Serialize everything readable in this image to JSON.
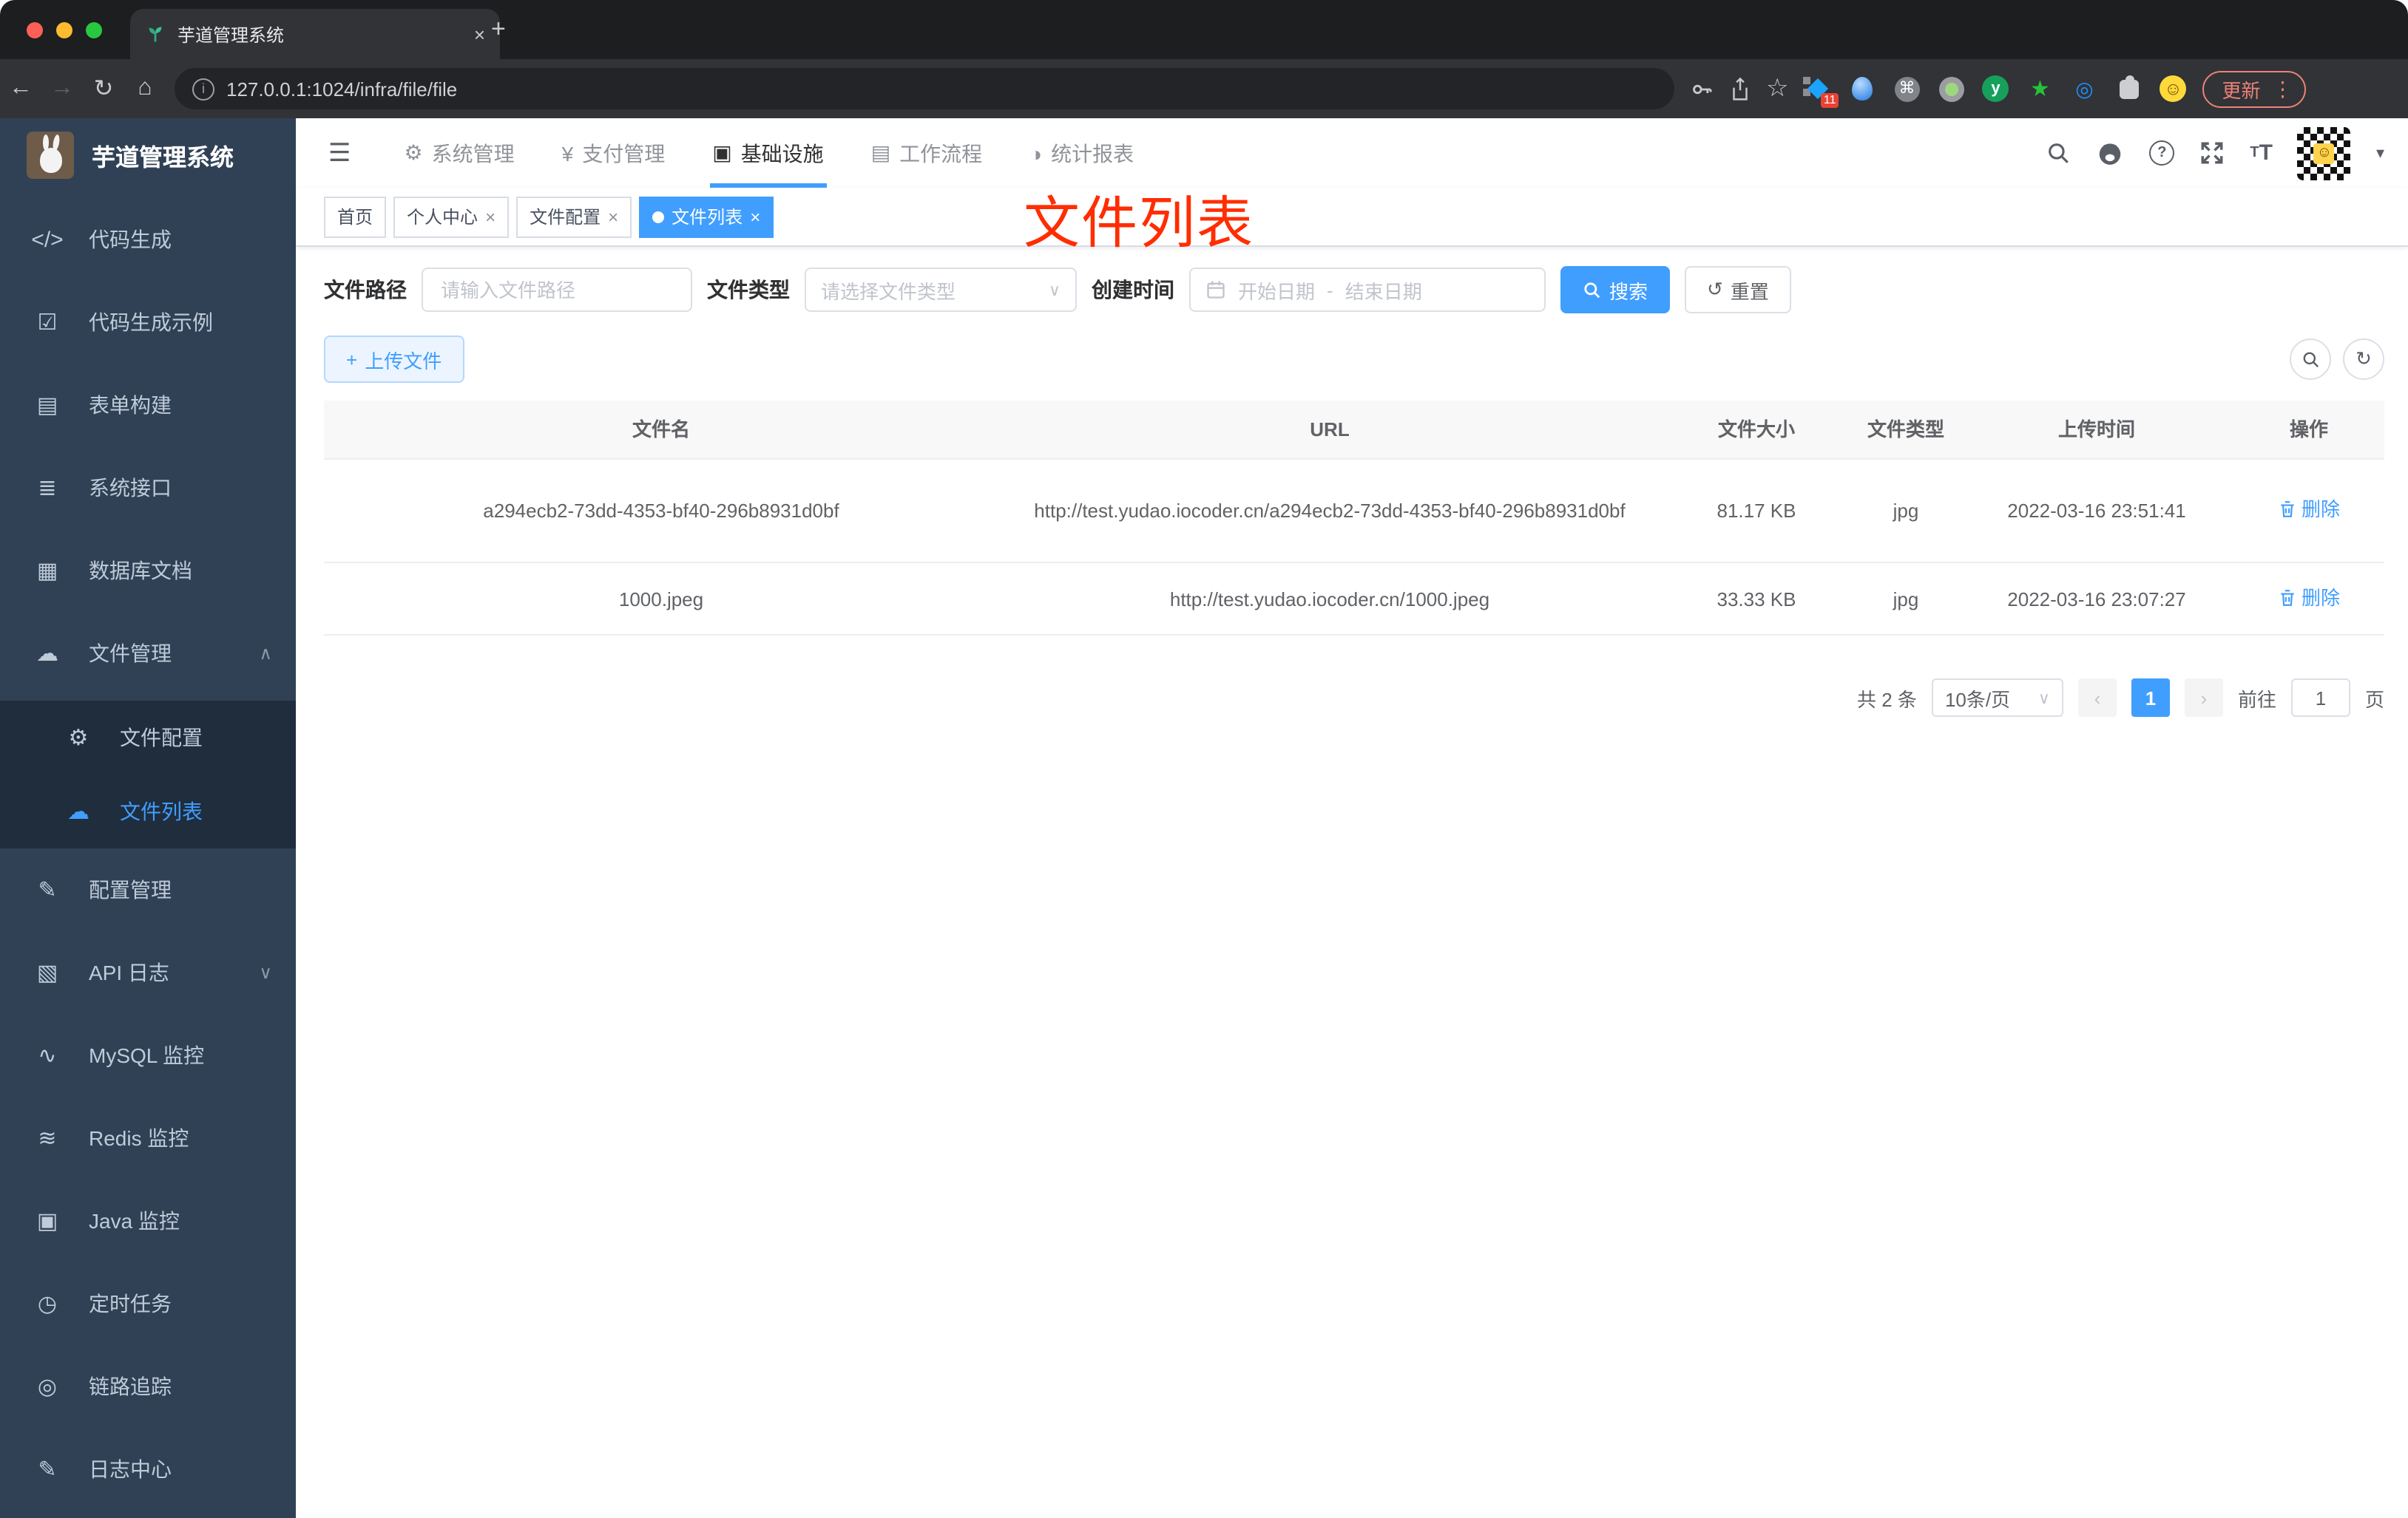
{
  "browser": {
    "tab_title": "芋道管理系统",
    "url": "127.0.0.1:1024/infra/file/file",
    "update_label": "更新",
    "extension_badge": "11"
  },
  "header": {
    "nav": [
      {
        "label": "系统管理"
      },
      {
        "label": "支付管理"
      },
      {
        "label": "基础设施"
      },
      {
        "label": "工作流程"
      },
      {
        "label": "统计报表"
      }
    ]
  },
  "sidebar": {
    "title": "芋道管理系统",
    "items": [
      {
        "label": "代码生成"
      },
      {
        "label": "代码生成示例"
      },
      {
        "label": "表单构建"
      },
      {
        "label": "系统接口"
      },
      {
        "label": "数据库文档"
      },
      {
        "label": "文件管理"
      },
      {
        "label": "文件配置"
      },
      {
        "label": "文件列表"
      },
      {
        "label": "配置管理"
      },
      {
        "label": "API 日志"
      },
      {
        "label": "MySQL 监控"
      },
      {
        "label": "Redis 监控"
      },
      {
        "label": "Java 监控"
      },
      {
        "label": "定时任务"
      },
      {
        "label": "链路追踪"
      },
      {
        "label": "日志中心"
      }
    ]
  },
  "tags": [
    {
      "label": "首页"
    },
    {
      "label": "个人中心"
    },
    {
      "label": "文件配置"
    },
    {
      "label": "文件列表"
    }
  ],
  "annotation": {
    "text": "文件列表"
  },
  "filters": {
    "path_label": "文件路径",
    "path_placeholder": "请输入文件路径",
    "type_label": "文件类型",
    "type_placeholder": "请选择文件类型",
    "date_label": "创建时间",
    "date_start_placeholder": "开始日期",
    "date_separator": "-",
    "date_end_placeholder": "结束日期",
    "search_label": "搜索",
    "reset_label": "重置"
  },
  "toolbar": {
    "upload_label": "上传文件"
  },
  "table": {
    "headers": [
      "文件名",
      "URL",
      "文件大小",
      "文件类型",
      "上传时间",
      "操作"
    ],
    "rows": [
      {
        "name": "a294ecb2-73dd-4353-bf40-296b8931d0bf",
        "url": "http://test.yudao.iocoder.cn/a294ecb2-73dd-4353-bf40-296b8931d0bf",
        "size": "81.17 KB",
        "type": "jpg",
        "time": "2022-03-16 23:51:41",
        "action": "删除"
      },
      {
        "name": "1000.jpeg",
        "url": "http://test.yudao.iocoder.cn/1000.jpeg",
        "size": "33.33 KB",
        "type": "jpg",
        "time": "2022-03-16 23:07:27",
        "action": "删除"
      }
    ]
  },
  "pagination": {
    "total": "共 2 条",
    "page_size": "10条/页",
    "current_page": "1",
    "goto_label": "前往",
    "goto_value": "1",
    "page_unit": "页"
  },
  "colors": {
    "primary": "#409eff",
    "sidebar_bg": "#304156",
    "submenu_bg": "#1f2d3d",
    "annotation": "#ff2d00"
  },
  "icons": {
    "close": "×",
    "plus": "+",
    "back": "←",
    "forward": "→",
    "reload": "↻",
    "home": "⌂",
    "star": "☆",
    "cmd": "⌘",
    "dots": "⋮",
    "caret": "▾",
    "chevron-up": "∧",
    "chevron-down": "∨",
    "code": "</>",
    "shield-check": "☑",
    "form": "▤",
    "api": "≣",
    "database": "▦",
    "cloud": "☁",
    "gear": "⚙",
    "edit": "✎",
    "log": "▧",
    "mysql": "∿",
    "redis": "≋",
    "java": "▣",
    "timer": "◷",
    "trace": "◎",
    "logcenter": "✎",
    "nav-gear": "⚙",
    "yen": "¥",
    "infra": "▣",
    "workflow": "▤",
    "report": "◑",
    "burger": "☰",
    "refresh": "↻",
    "reset": "↺",
    "select-caret": "∨",
    "page-prev": "‹",
    "page-next": "›",
    "star-ext": "★",
    "eye-ext": "◎",
    "smile": "☺",
    "y-letter": "y"
  }
}
